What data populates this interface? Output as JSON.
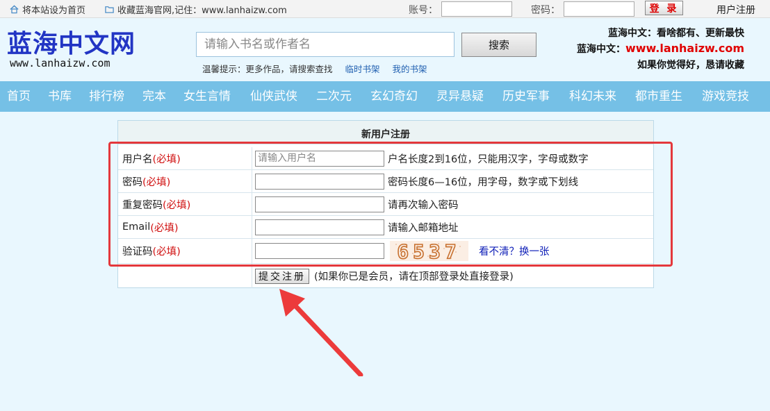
{
  "topbar": {
    "set_home": "将本站设为首页",
    "bookmark": "收藏蓝海官网,记住：www.lanhaizw.com",
    "account_label": "账号：",
    "password_label": "密码：",
    "login_button": "登 录",
    "register_link": "用户注册"
  },
  "header": {
    "logo": "蓝海中文网",
    "logo_url": "www.lanhaizw.com",
    "search_placeholder": "请输入书名或作者名",
    "search_button": "搜索",
    "tip": "温馨提示：更多作品，请搜索查找",
    "temp_shelf": "临时书架",
    "my_shelf": "我的书架",
    "slogan1": "蓝海中文：看啥都有、更新最快",
    "slogan2_prefix": "蓝海中文：",
    "slogan2_url": "www.lanhaizw.com",
    "slogan3": "如果你觉得好，恳请收藏"
  },
  "nav": [
    "首页",
    "书库",
    "排行榜",
    "完本",
    "女生言情",
    "仙侠武侠",
    "二次元",
    "玄幻奇幻",
    "灵异悬疑",
    "历史军事",
    "科幻未来",
    "都市重生",
    "游戏竞技"
  ],
  "form": {
    "title": "新用户注册",
    "required": "(必填)",
    "rows": [
      {
        "label": "用户名",
        "placeholder": "请输入用户名",
        "hint": "户名长度2到16位，只能用汉字，字母或数字"
      },
      {
        "label": "密码",
        "placeholder": "",
        "hint": "密码长度6—16位，用字母，数字或下划线"
      },
      {
        "label": "重复密码",
        "placeholder": "",
        "hint": "请再次输入密码"
      },
      {
        "label": "Email",
        "placeholder": "",
        "hint": "请输入邮箱地址"
      },
      {
        "label": "验证码",
        "placeholder": "",
        "hint": ""
      }
    ],
    "captcha_text": "6537",
    "refresh": "看不清？换一张",
    "submit": "提交注册",
    "submit_note": "(如果你已是会员，请在顶部登录处直接登录)"
  },
  "colors": {
    "nav_bg": "#75c0e6",
    "page_bg": "#e9f7fe",
    "logo": "#2235c4",
    "required": "#d01010",
    "highlight": "#e4383c"
  }
}
